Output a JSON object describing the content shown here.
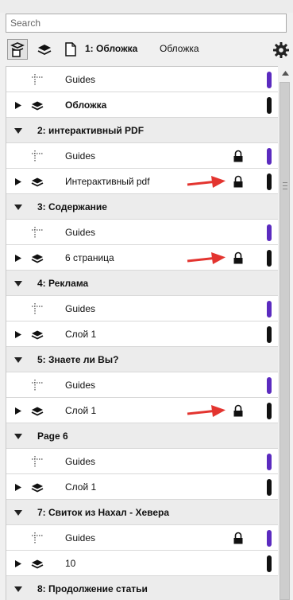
{
  "search": {
    "placeholder": "Search",
    "value": ""
  },
  "toolbar": {
    "page_title": "1: Обложка",
    "layer_name": "Обложка"
  },
  "colors": {
    "guides_tab": "#5b2bbf",
    "layer_tab": "#111111",
    "arrow": "#e3342f"
  },
  "rows": [
    {
      "kind": "item",
      "icon": "guides-icon",
      "label": "Guides",
      "bold": false,
      "locked": false,
      "expander": false,
      "tab": "purple"
    },
    {
      "kind": "item",
      "icon": "layer-icon",
      "label": "Обложка",
      "bold": true,
      "locked": false,
      "expander": true,
      "tab": "black"
    },
    {
      "kind": "page",
      "label": "2: интерактивный PDF"
    },
    {
      "kind": "item",
      "icon": "guides-icon",
      "label": "Guides",
      "bold": false,
      "locked": true,
      "expander": false,
      "tab": "purple"
    },
    {
      "kind": "item",
      "icon": "layer-icon",
      "label": "Интерактивный pdf",
      "bold": false,
      "locked": true,
      "expander": true,
      "tab": "black",
      "arrow": true
    },
    {
      "kind": "page",
      "label": "3: Содержание"
    },
    {
      "kind": "item",
      "icon": "guides-icon",
      "label": "Guides",
      "bold": false,
      "locked": false,
      "expander": false,
      "tab": "purple"
    },
    {
      "kind": "item",
      "icon": "layer-icon",
      "label": "6 страница",
      "bold": false,
      "locked": true,
      "expander": true,
      "tab": "black",
      "arrow": true
    },
    {
      "kind": "page",
      "label": "4: Реклама"
    },
    {
      "kind": "item",
      "icon": "guides-icon",
      "label": "Guides",
      "bold": false,
      "locked": false,
      "expander": false,
      "tab": "purple"
    },
    {
      "kind": "item",
      "icon": "layer-icon",
      "label": "Слой 1",
      "bold": false,
      "locked": false,
      "expander": true,
      "tab": "black"
    },
    {
      "kind": "page",
      "label": "5: Знаете ли Вы?"
    },
    {
      "kind": "item",
      "icon": "guides-icon",
      "label": "Guides",
      "bold": false,
      "locked": false,
      "expander": false,
      "tab": "purple"
    },
    {
      "kind": "item",
      "icon": "layer-icon",
      "label": "Слой 1",
      "bold": false,
      "locked": true,
      "expander": true,
      "tab": "black",
      "arrow": true
    },
    {
      "kind": "page",
      "label": "Page 6"
    },
    {
      "kind": "item",
      "icon": "guides-icon",
      "label": "Guides",
      "bold": false,
      "locked": false,
      "expander": false,
      "tab": "purple"
    },
    {
      "kind": "item",
      "icon": "layer-icon",
      "label": "Слой 1",
      "bold": false,
      "locked": false,
      "expander": true,
      "tab": "black"
    },
    {
      "kind": "page",
      "label": "7: Свиток из Нахал - Хевера"
    },
    {
      "kind": "item",
      "icon": "guides-icon",
      "label": "Guides",
      "bold": false,
      "locked": true,
      "expander": false,
      "tab": "purple"
    },
    {
      "kind": "item",
      "icon": "layer-icon",
      "label": "10",
      "bold": false,
      "locked": false,
      "expander": true,
      "tab": "black"
    },
    {
      "kind": "page",
      "label": "8: Продолжение статьи"
    }
  ]
}
